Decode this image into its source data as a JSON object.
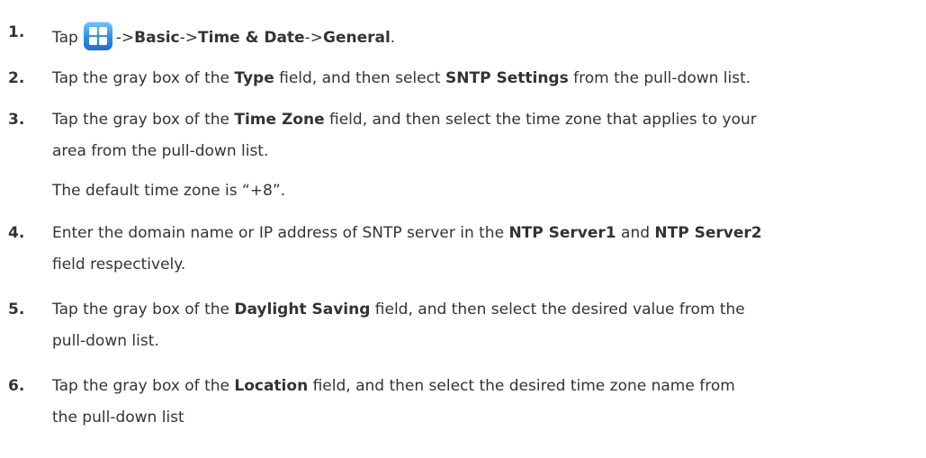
{
  "steps": [
    {
      "number": "1.",
      "lines": [
        {
          "pre": "Tap",
          "after_icon": "->",
          "b1": "Basic",
          "t2": "->",
          "b2": "Time & Date",
          "t3": "->",
          "b3": "General",
          "t4": "."
        }
      ],
      "icon": "menu-grid-icon"
    },
    {
      "number": "2.",
      "lines": [
        {
          "t1": "Tap the gray box of the ",
          "b1": "Type",
          "t2": " field, and then select ",
          "b2": "SNTP Settings",
          "t3": " from the pull-down list."
        }
      ]
    },
    {
      "number": "3.",
      "lines": [
        {
          "t1": "Tap the gray box of the ",
          "b1": "Time Zone",
          "t2": " field, and then select the time zone that applies to your"
        },
        {
          "t1": "area from the pull-down list."
        },
        {
          "t1": "The default time zone is “+8”."
        }
      ]
    },
    {
      "number": "4.",
      "lines": [
        {
          "t1": "Enter the domain name or IP address of SNTP server in the ",
          "b1": "NTP Server1",
          "t2": " and ",
          "b2": "NTP Server2"
        },
        {
          "t1": "field respectively."
        }
      ]
    },
    {
      "number": "5.",
      "lines": [
        {
          "t1": "Tap the gray box of the ",
          "b1": "Daylight Saving",
          "t2": " field, and then select the desired value from the"
        },
        {
          "t1": "pull-down list."
        }
      ]
    },
    {
      "number": "6.",
      "lines": [
        {
          "t1": "Tap the gray box of the ",
          "b1": "Location",
          "t2": " field, and then select the desired time zone name from"
        },
        {
          "t1": "the pull-down list"
        }
      ]
    }
  ],
  "colors": {
    "text": "#333333",
    "icon_blue": "#2f8ee8"
  }
}
